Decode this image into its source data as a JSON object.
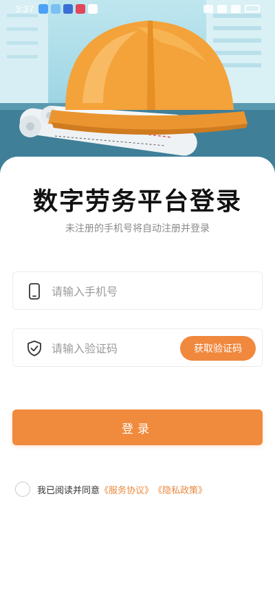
{
  "status_bar": {
    "time": "3:37"
  },
  "hero": {
    "icon": "hard-hat-illustration"
  },
  "page": {
    "title": "数字劳务平台登录",
    "subtitle": "未注册的手机号将自动注册并登录"
  },
  "form": {
    "phone": {
      "placeholder": "请输入手机号",
      "value": "",
      "icon": "phone-icon"
    },
    "code": {
      "placeholder": "请输入验证码",
      "value": "",
      "icon": "shield-check-icon"
    },
    "get_code_label": "获取验证码",
    "login_label": "登录"
  },
  "agreement": {
    "prefix": "我已阅读并同意",
    "service_link": "《服务协议》",
    "privacy_link": "《隐私政策》",
    "checked": false
  },
  "colors": {
    "accent": "#f08a3c",
    "link": "#e8893e",
    "hero_sky": "#a8dbe8",
    "helmet": "#f4a23a"
  }
}
